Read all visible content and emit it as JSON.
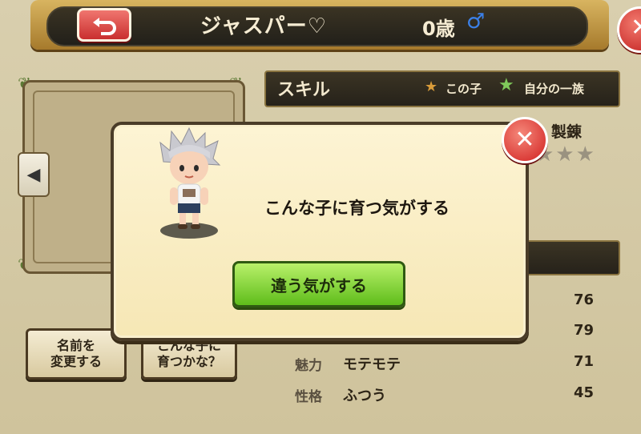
{
  "header": {
    "name": "ジャスパー♡",
    "age": "0歳",
    "gender_symbol": "♂"
  },
  "skills": {
    "title": "スキル",
    "legend_this_child": "この子",
    "legend_family": "自分の一族",
    "column_label": "製錬"
  },
  "stats": [
    {
      "label": "",
      "value_text": "",
      "number": "76"
    },
    {
      "label": "",
      "value_text": "",
      "number": "79"
    },
    {
      "label": "魅力",
      "value_text": "モテモテ",
      "number": "71"
    },
    {
      "label": "性格",
      "value_text": "ふつう",
      "number": "45"
    }
  ],
  "left_buttons": {
    "rename": "名前を\n変更する",
    "future": "こんな子に\n育つかな？"
  },
  "dialog": {
    "message": "こんな子に育つ気がする",
    "button_label": "違う気がする"
  },
  "colors": {
    "accent_green": "#5fbd1b",
    "close_red": "#d12020",
    "gender_blue": "#3b80e8"
  }
}
